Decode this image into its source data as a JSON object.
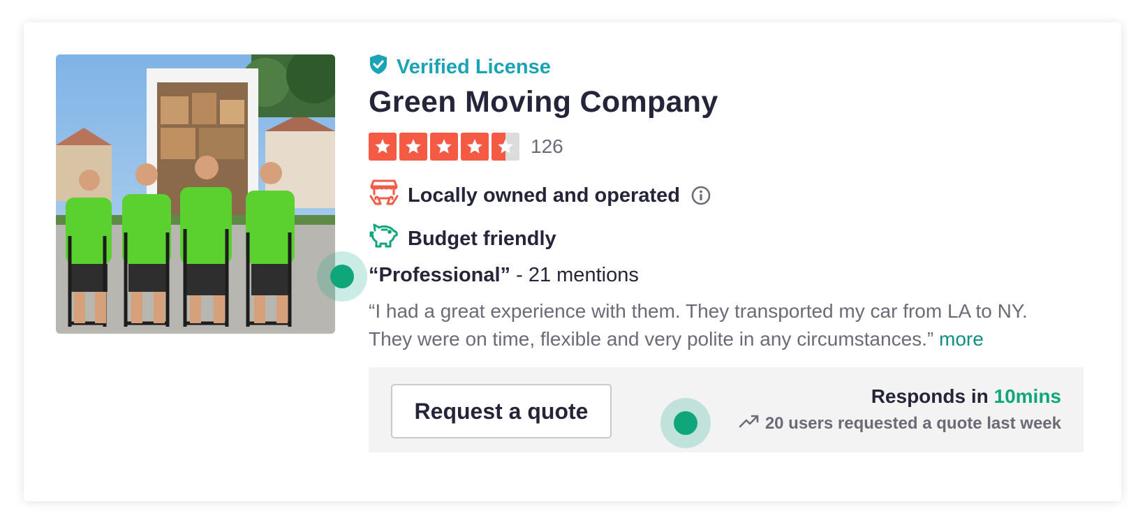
{
  "listing": {
    "verified_label": "Verified License",
    "company_name": "Green Moving Company",
    "rating": {
      "stars": 4.5,
      "max_stars": 5,
      "review_count": "126"
    },
    "features": [
      {
        "label": "Locally owned and operated",
        "icon": "local-owner-icon",
        "has_info": true
      },
      {
        "label": "Budget friendly",
        "icon": "piggy-bank-icon",
        "has_info": false
      }
    ],
    "mention": {
      "keyword": "“Professional”",
      "count_text": "- 21 mentions"
    },
    "review_quote": "“I had a great experience with them. They transported my car from LA to NY. They were on time, flexible and very polite in any circumstances.”",
    "more_link": "more",
    "action_bar": {
      "quote_button": "Request a quote",
      "responds_prefix": "Responds in ",
      "responds_time": "10mins",
      "requested_text": "20 users requested a quote last week"
    }
  },
  "colors": {
    "brand_teal": "#1aa3b5",
    "star_red": "#f55a44",
    "accent_green": "#0fa67c",
    "text_dark": "#25253a",
    "text_muted": "#6b6b78"
  }
}
